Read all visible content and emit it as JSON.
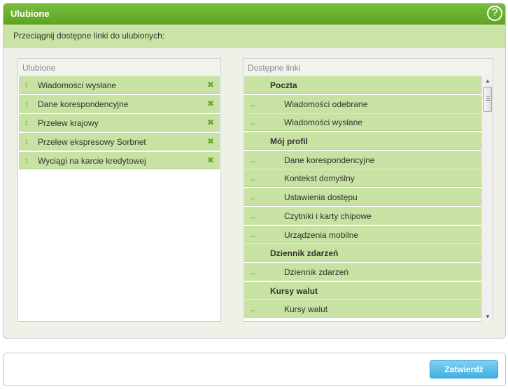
{
  "dialog": {
    "title": "Ulubione",
    "help_icon": "?",
    "instruction": "Przeciągnij dostępne linki do ulubionych:"
  },
  "favorites": {
    "header": "Ulubione",
    "drag_icon": "↕",
    "remove_icon": "✖",
    "items": [
      {
        "label": "Wiadomości wysłane"
      },
      {
        "label": "Dane korespondencyjne"
      },
      {
        "label": "Przelew krajowy"
      },
      {
        "label": "Przelew ekspresowy Sorbnet"
      },
      {
        "label": "Wyciągi na karcie kredytowej"
      }
    ]
  },
  "available": {
    "header": "Dostępne linki",
    "arrow_icon": "←",
    "items": [
      {
        "label": "Poczta",
        "group": true
      },
      {
        "label": "Wiadomości odebrane",
        "group": false
      },
      {
        "label": "Wiadomości wysłane",
        "group": false
      },
      {
        "label": "Mój profil",
        "group": true
      },
      {
        "label": "Dane korespondencyjne",
        "group": false
      },
      {
        "label": "Kontekst domyślny",
        "group": false
      },
      {
        "label": "Ustawienia dostępu",
        "group": false
      },
      {
        "label": "Czytniki i karty chipowe",
        "group": false
      },
      {
        "label": "Urządzenia mobilne",
        "group": false
      },
      {
        "label": "Dziennik zdarzeń",
        "group": true
      },
      {
        "label": "Dziennik zdarzeń",
        "group": false
      },
      {
        "label": "Kursy walut",
        "group": true
      },
      {
        "label": "Kursy walut",
        "group": false
      }
    ]
  },
  "footer": {
    "confirm_label": "Zatwierdź"
  },
  "colors": {
    "accent_green": "#6aaa34",
    "row_green": "#c7e2a2",
    "button_blue": "#3fb0e2"
  }
}
